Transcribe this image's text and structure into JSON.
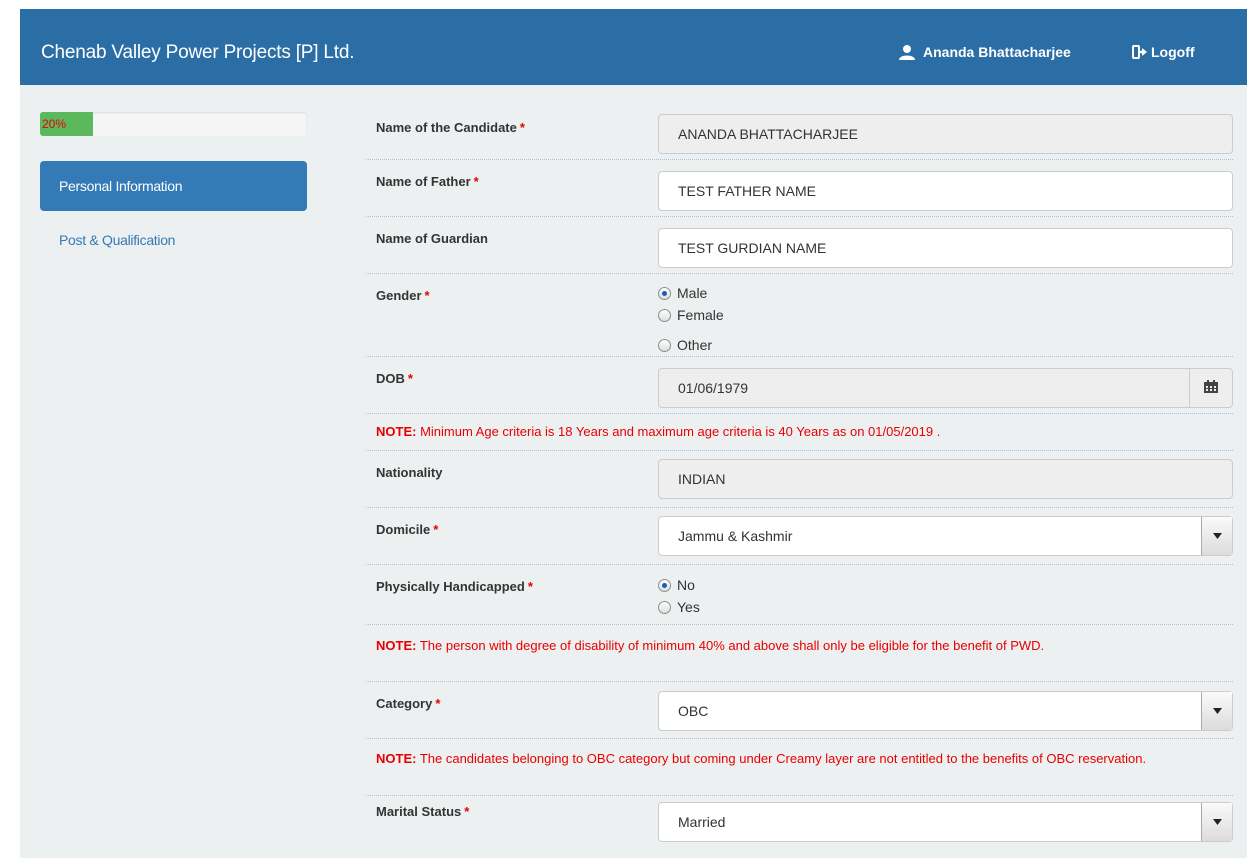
{
  "header": {
    "brand": "Chenab Valley Power Projects [P] Ltd.",
    "user_name": "Ananda Bhattacharjee",
    "logoff_label": "Logoff"
  },
  "sidebar": {
    "progress": {
      "label": "20%",
      "value": 20
    },
    "items": [
      {
        "label": "Personal Information",
        "active": true
      },
      {
        "label": "Post & Qualification",
        "active": false
      }
    ]
  },
  "form": {
    "candidate_name": {
      "label": "Name of the Candidate",
      "value": "ANANDA BHATTACHARJEE"
    },
    "father_name": {
      "label": "Name of Father",
      "value": "TEST FATHER NAME"
    },
    "guardian_name": {
      "label": "Name of Guardian",
      "value": "TEST GURDIAN NAME"
    },
    "gender": {
      "label": "Gender",
      "options": [
        "Male",
        "Female",
        "Other"
      ],
      "selected": "Male"
    },
    "dob": {
      "label": "DOB",
      "value": "01/06/1979"
    },
    "age_note": {
      "prefix": "NOTE:",
      "text": " Minimum Age criteria is 18 Years and maximum age criteria is 40 Years as on 01/05/2019 ."
    },
    "nationality": {
      "label": "Nationality",
      "value": "INDIAN"
    },
    "domicile": {
      "label": "Domicile",
      "value": "Jammu & Kashmir"
    },
    "handicapped": {
      "label": "Physically Handicapped",
      "options": [
        "No",
        "Yes"
      ],
      "selected": "No"
    },
    "pwd_note": {
      "prefix": "NOTE:",
      "text": " The person with degree of disability of minimum 40% and above shall only be eligible for the benefit of PWD."
    },
    "category": {
      "label": "Category",
      "value": "OBC"
    },
    "obc_note": {
      "prefix": "NOTE:",
      "text": " The candidates belonging to OBC category but coming under Creamy layer are not entitled to the benefits of OBC reservation."
    },
    "marital_status": {
      "label": "Marital Status",
      "value": "Married"
    },
    "required_marker": "*"
  },
  "colors": {
    "header_bg": "#2b6ea6",
    "active_nav": "#337ab7",
    "progress": "#5cb85c",
    "note": "#e80000"
  }
}
